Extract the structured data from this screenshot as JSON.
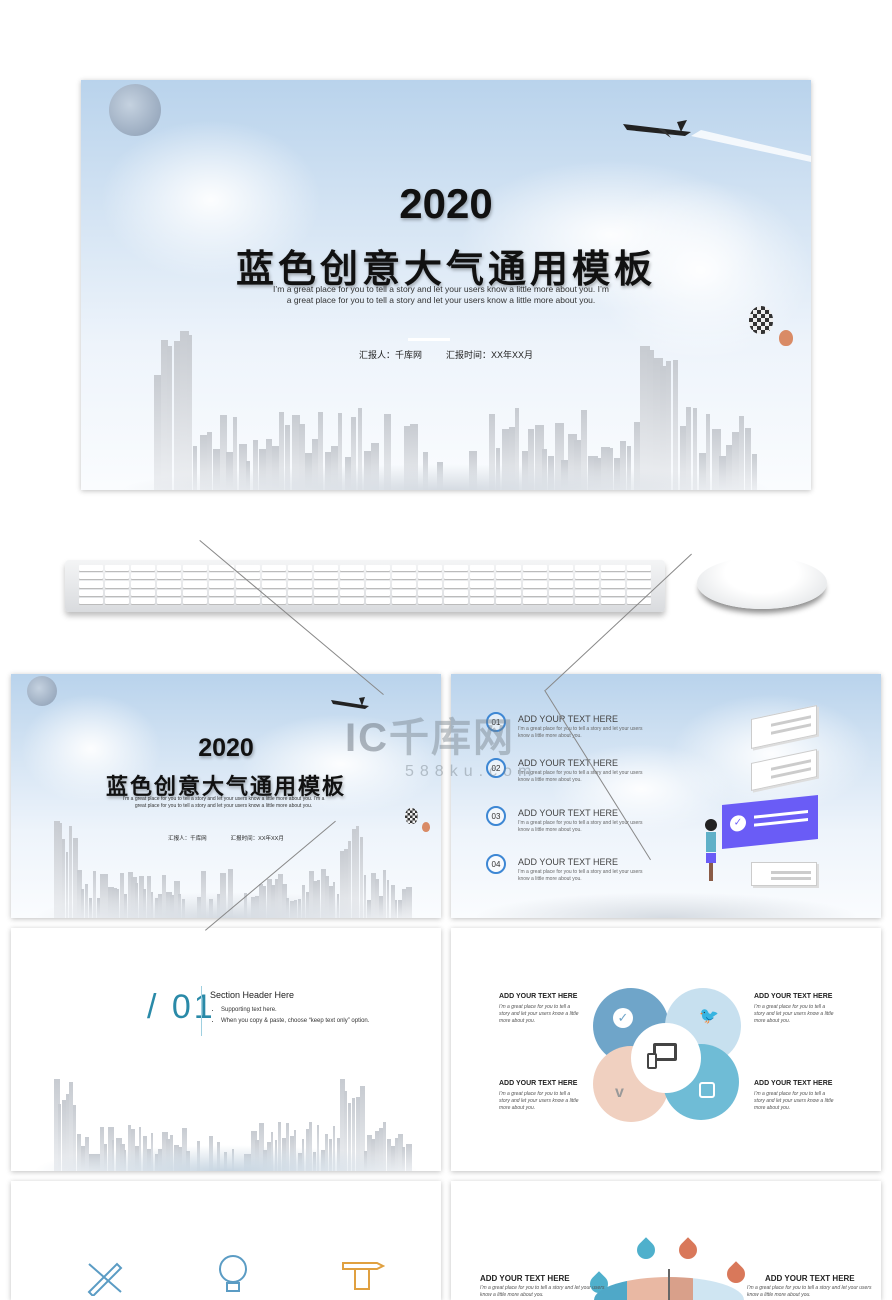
{
  "cover": {
    "year": "2020",
    "title": "蓝色创意大气通用模板",
    "subtitle": "I’m a great place for you to tell a story and let your users know a little more about you. I’m a great place for you to tell a story and let your users know a little more about you.",
    "reporter": "汇报人：千库网",
    "date": "汇报时间：XX年XX月"
  },
  "watermark": {
    "brand": "千库网",
    "url": "588ku.com"
  },
  "agenda": {
    "items": [
      {
        "num": "01",
        "title": "ADD YOUR TEXT HERE",
        "body": "I’m a great place for you to tell a story and let your users know a little more about you."
      },
      {
        "num": "02",
        "title": "ADD YOUR TEXT HERE",
        "body": "I’m a great place for you to tell a story and let your users know a little more about you."
      },
      {
        "num": "03",
        "title": "ADD YOUR TEXT HERE",
        "body": "I’m a great place for you to tell a story and let your users know a little more about you."
      },
      {
        "num": "04",
        "title": "ADD YOUR TEXT HERE",
        "body": "I’m a great place for you to tell a story and let your users know a little more about you."
      }
    ],
    "accent": "#6a5cf6"
  },
  "section": {
    "number": "/ 01",
    "header": "Section Header Here",
    "bullets": [
      "Supporting text here.",
      "When you copy & paste, choose “keep text only” option."
    ],
    "accent": "#2a8aa8"
  },
  "social": {
    "items": [
      {
        "title": "ADD YOUR TEXT HERE",
        "body": "I’m a great place for you to tell a story and let your users know a little more about you.",
        "icon": "check-icon"
      },
      {
        "title": "ADD YOUR TEXT HERE",
        "body": "I’m a great place for you to tell a story and let your users know a little more about you.",
        "icon": "twitter-icon"
      },
      {
        "title": "ADD YOUR TEXT HERE",
        "body": "I’m a great place for you to tell a story and let your users know a little more about you.",
        "icon": "vimeo-icon"
      },
      {
        "title": "ADD YOUR TEXT HERE",
        "body": "I’m a great place for you to tell a story and let your users know a little more about you.",
        "icon": "instagram-icon"
      }
    ],
    "center_icon": "devices-icon"
  },
  "slide6": {
    "items": [
      {
        "title": "ADD YOUR TEXT HERE",
        "body": "I’m a great place for you to tell a story and let your users know a little more about you."
      },
      {
        "title": "ADD YOUR TEXT HERE",
        "body": "I’m a great place for you to tell a story and let your users know a little more about you."
      }
    ]
  },
  "colors": {
    "sky": "#b9d3ec",
    "blue": "#5b9cc4",
    "peach": "#e8b9a3",
    "orange": "#d9785a",
    "teal": "#4fb0cc"
  }
}
